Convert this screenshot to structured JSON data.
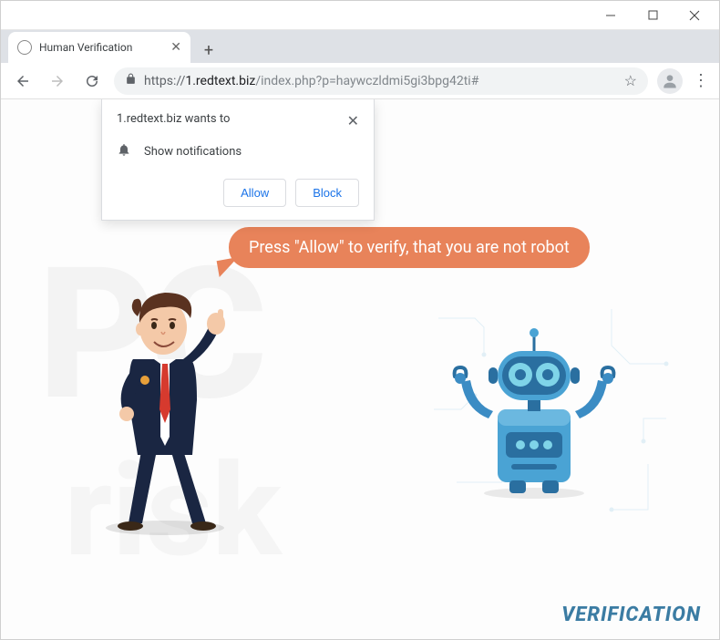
{
  "window": {
    "tab_title": "Human Verification",
    "url_proto": "https://",
    "url_host": "1.redtext.biz",
    "url_path": "/index.php?p=haywczldmi5gi3bpg42ti#"
  },
  "permission_prompt": {
    "origin_text": "1.redtext.biz wants to",
    "capability": "Show notifications",
    "allow_label": "Allow",
    "block_label": "Block"
  },
  "page": {
    "bubble_text": "Press \"Allow\" to verify, that you are not robot",
    "footer_label": "VERIFICATION"
  },
  "watermark": {
    "line1": "PC",
    "line2": "risk"
  },
  "colors": {
    "bubble": "#e8835a",
    "chrome_blue": "#1a73e8",
    "verification": "#3b7ca3"
  }
}
